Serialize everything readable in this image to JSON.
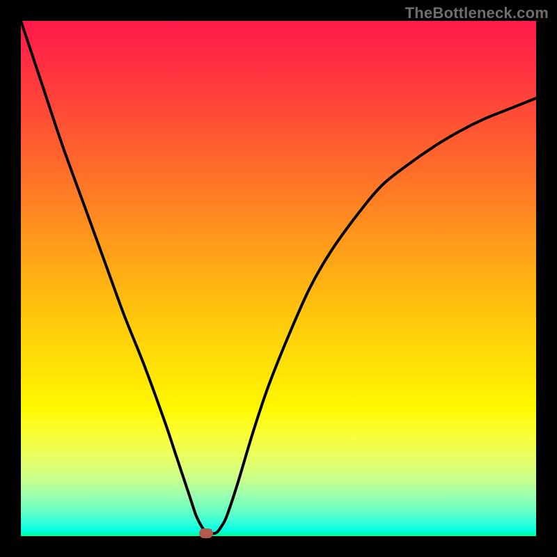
{
  "watermark": "TheBottleneck.com",
  "chart_data": {
    "type": "line",
    "title": "",
    "xlabel": "",
    "ylabel": "",
    "xlim": [
      0,
      100
    ],
    "ylim": [
      0,
      100
    ],
    "series": [
      {
        "name": "curve",
        "x": [
          0,
          4,
          8,
          12,
          16,
          20,
          24,
          28,
          30,
          32,
          33,
          34,
          35,
          36,
          37,
          38,
          39,
          40,
          42,
          45,
          48,
          52,
          56,
          60,
          65,
          70,
          75,
          80,
          85,
          90,
          95,
          100
        ],
        "values": [
          100,
          88,
          76,
          65,
          54,
          43,
          33,
          22,
          16,
          10,
          7,
          4,
          2,
          0.7,
          0.5,
          0.7,
          2,
          4,
          10,
          20,
          29,
          39,
          48,
          55,
          62,
          68,
          72,
          75.5,
          78.5,
          81,
          83,
          85
        ]
      }
    ],
    "marker": {
      "x": 36,
      "y": 0.5,
      "color": "#b35a4f"
    },
    "gradient_stops": [
      {
        "pos": 0,
        "color": "#ff1a4a"
      },
      {
        "pos": 0.5,
        "color": "#ffc90c"
      },
      {
        "pos": 0.78,
        "color": "#fff700"
      },
      {
        "pos": 1.0,
        "color": "#00ff88"
      }
    ]
  }
}
